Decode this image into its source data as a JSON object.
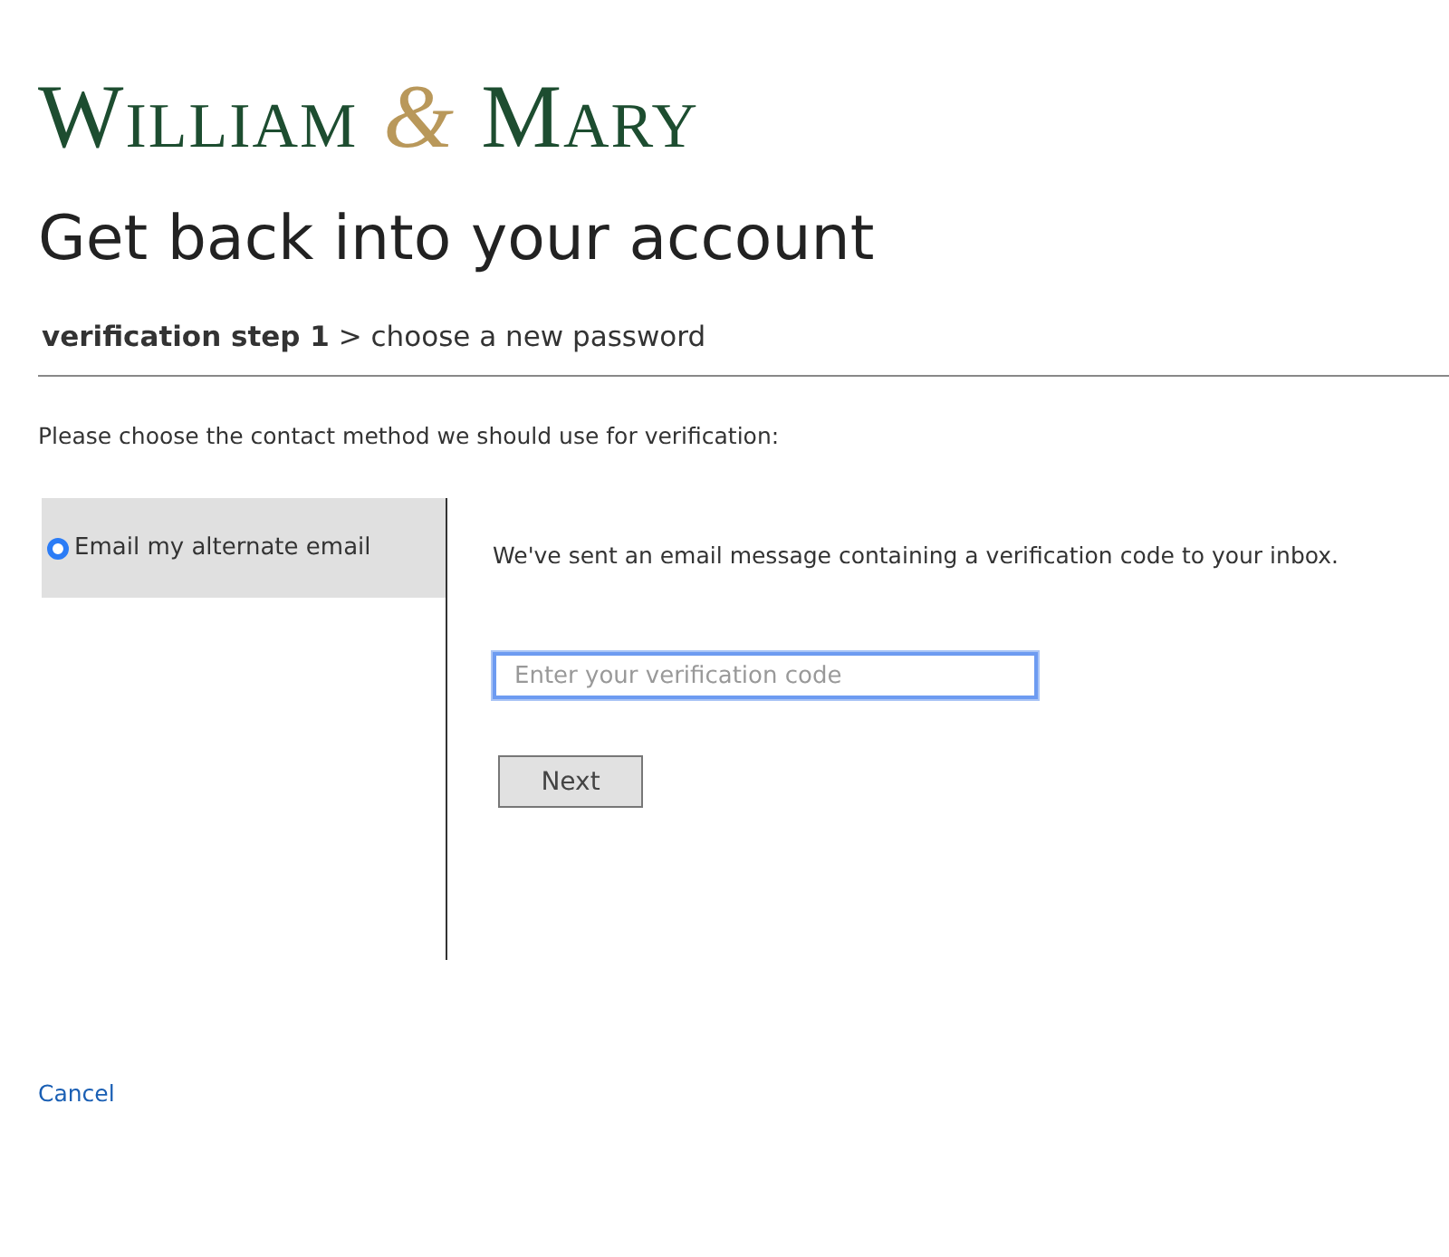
{
  "logo": {
    "first": "William",
    "ampersand": "&",
    "second": "Mary"
  },
  "title": "Get back into your account",
  "breadcrumb": "**verification step 1** > choose a new password",
  "instruction": "Please choose the contact method we should use for verification:",
  "methods": [
    {
      "label": "Email my alternate email",
      "selected": true
    }
  ],
  "message": "We've sent an email message containing a verification code to your inbox.",
  "code_field": {
    "placeholder": "Enter your verification code",
    "focused": true
  },
  "next_button": "Next",
  "cancel_link": "Cancel"
}
